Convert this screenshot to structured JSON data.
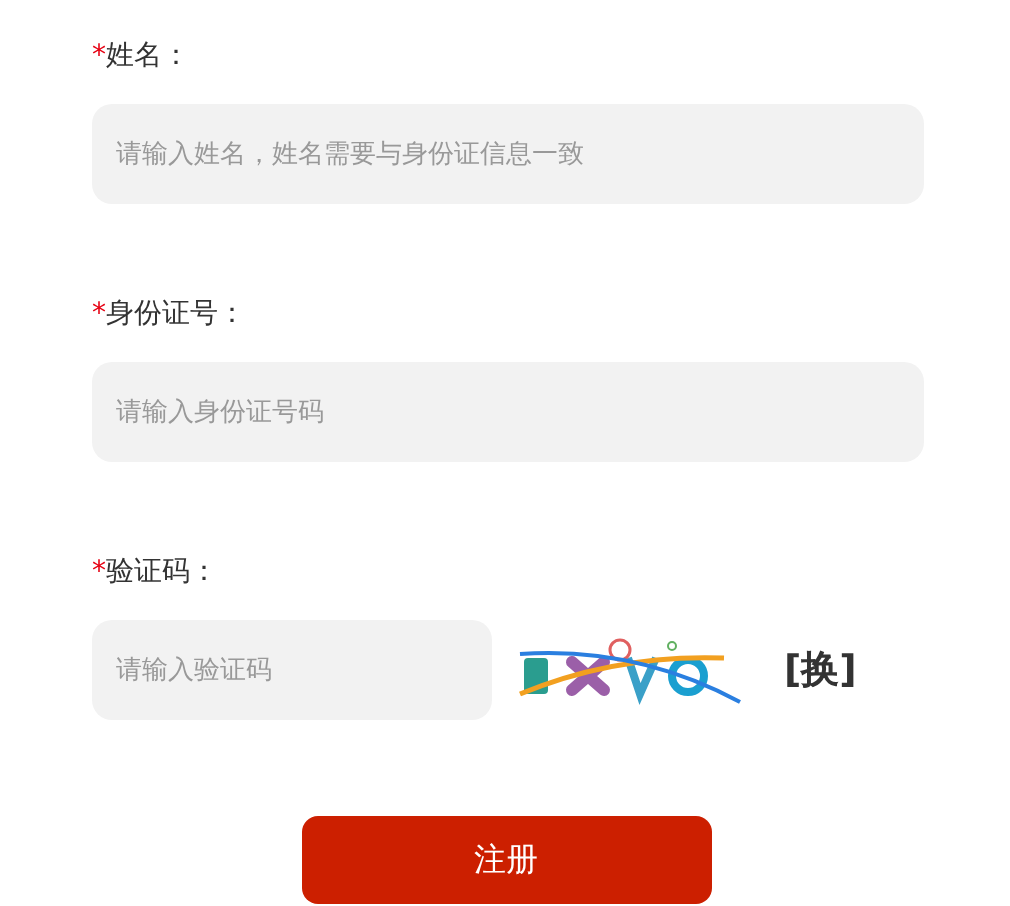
{
  "fields": [
    {
      "kind": "text",
      "required_mark": "*",
      "label": "姓名：",
      "placeholder": "请输入姓名，姓名需要与身份证信息一致"
    },
    {
      "kind": "text",
      "required_mark": "*",
      "label": "身份证号：",
      "placeholder": "请输入身份证号码"
    },
    {
      "kind": "captcha",
      "required_mark": "*",
      "label": "验证码：",
      "placeholder": "请输入验证码",
      "refresh": "[换]"
    }
  ],
  "submit": "注册"
}
